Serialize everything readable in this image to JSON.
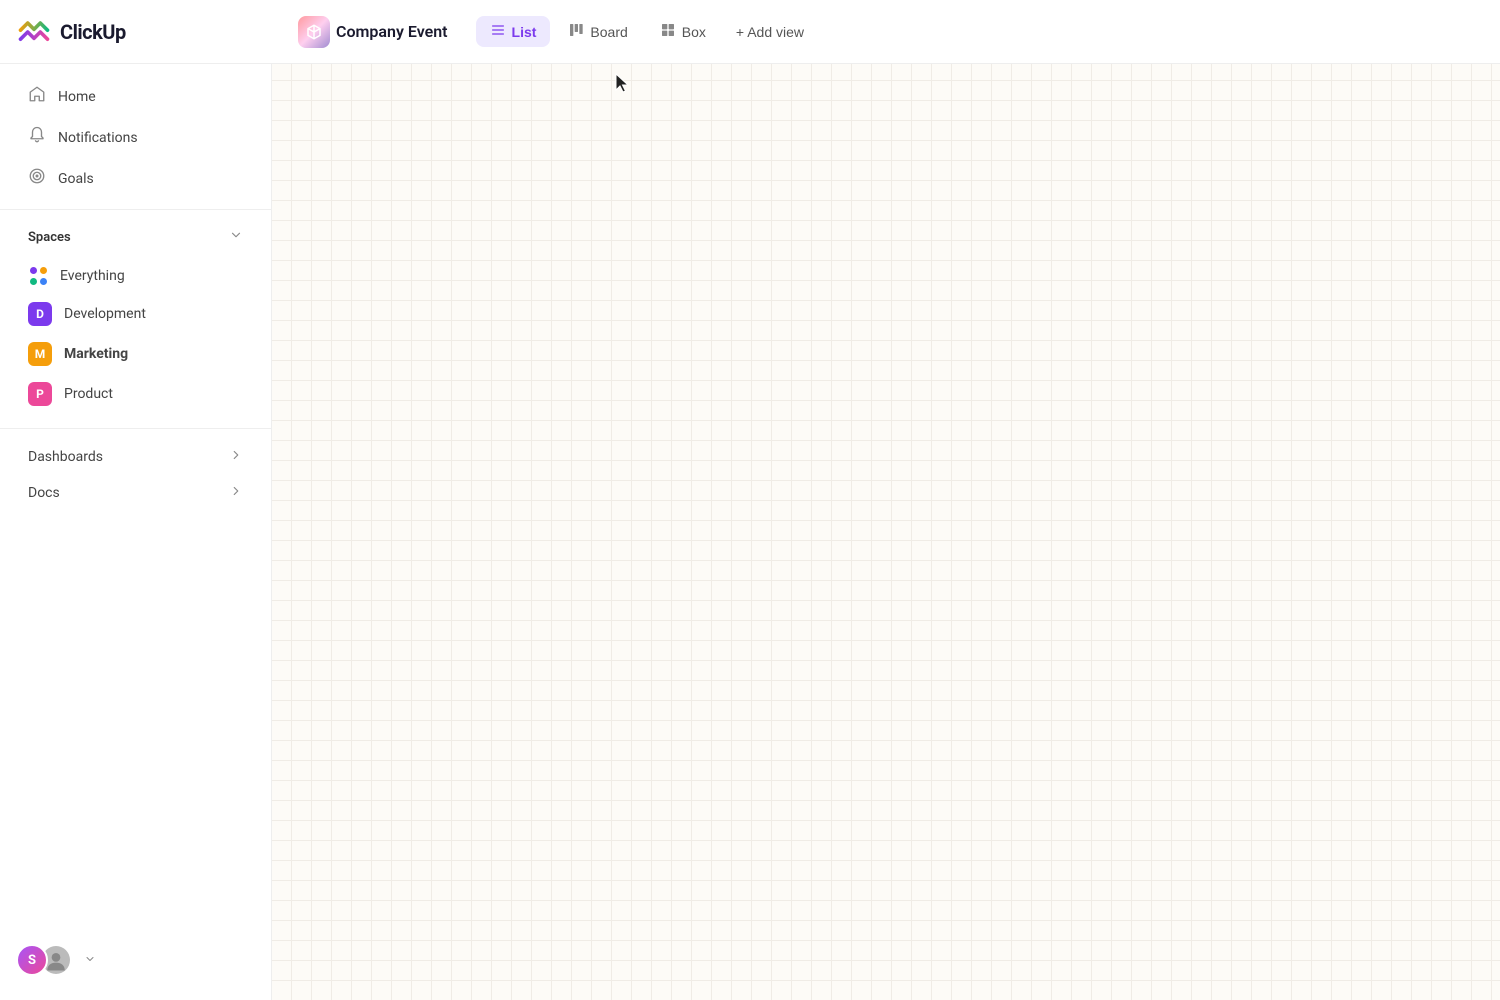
{
  "logo": {
    "text": "ClickUp"
  },
  "project": {
    "name": "Company Event",
    "icon_alt": "box-icon"
  },
  "views": [
    {
      "id": "list",
      "label": "List",
      "icon": "list-icon",
      "active": true
    },
    {
      "id": "board",
      "label": "Board",
      "icon": "board-icon",
      "active": false
    },
    {
      "id": "box",
      "label": "Box",
      "icon": "box-view-icon",
      "active": false
    }
  ],
  "add_view_label": "+ Add view",
  "sidebar": {
    "nav_items": [
      {
        "id": "home",
        "label": "Home",
        "icon": "home-icon"
      },
      {
        "id": "notifications",
        "label": "Notifications",
        "icon": "bell-icon"
      },
      {
        "id": "goals",
        "label": "Goals",
        "icon": "goals-icon"
      }
    ],
    "spaces_section": {
      "label": "Spaces",
      "chevron": "chevron-down-icon"
    },
    "spaces": [
      {
        "id": "everything",
        "label": "Everything",
        "type": "dots"
      },
      {
        "id": "development",
        "label": "Development",
        "initial": "D",
        "color": "#7c3aed"
      },
      {
        "id": "marketing",
        "label": "Marketing",
        "initial": "M",
        "color": "#f59e0b",
        "active": true
      },
      {
        "id": "product",
        "label": "Product",
        "initial": "P",
        "color": "#ec4899"
      }
    ],
    "collapsible_items": [
      {
        "id": "dashboards",
        "label": "Dashboards"
      },
      {
        "id": "docs",
        "label": "Docs"
      }
    ],
    "user": {
      "initial": "S",
      "chevron": "chevron-down-icon"
    }
  }
}
